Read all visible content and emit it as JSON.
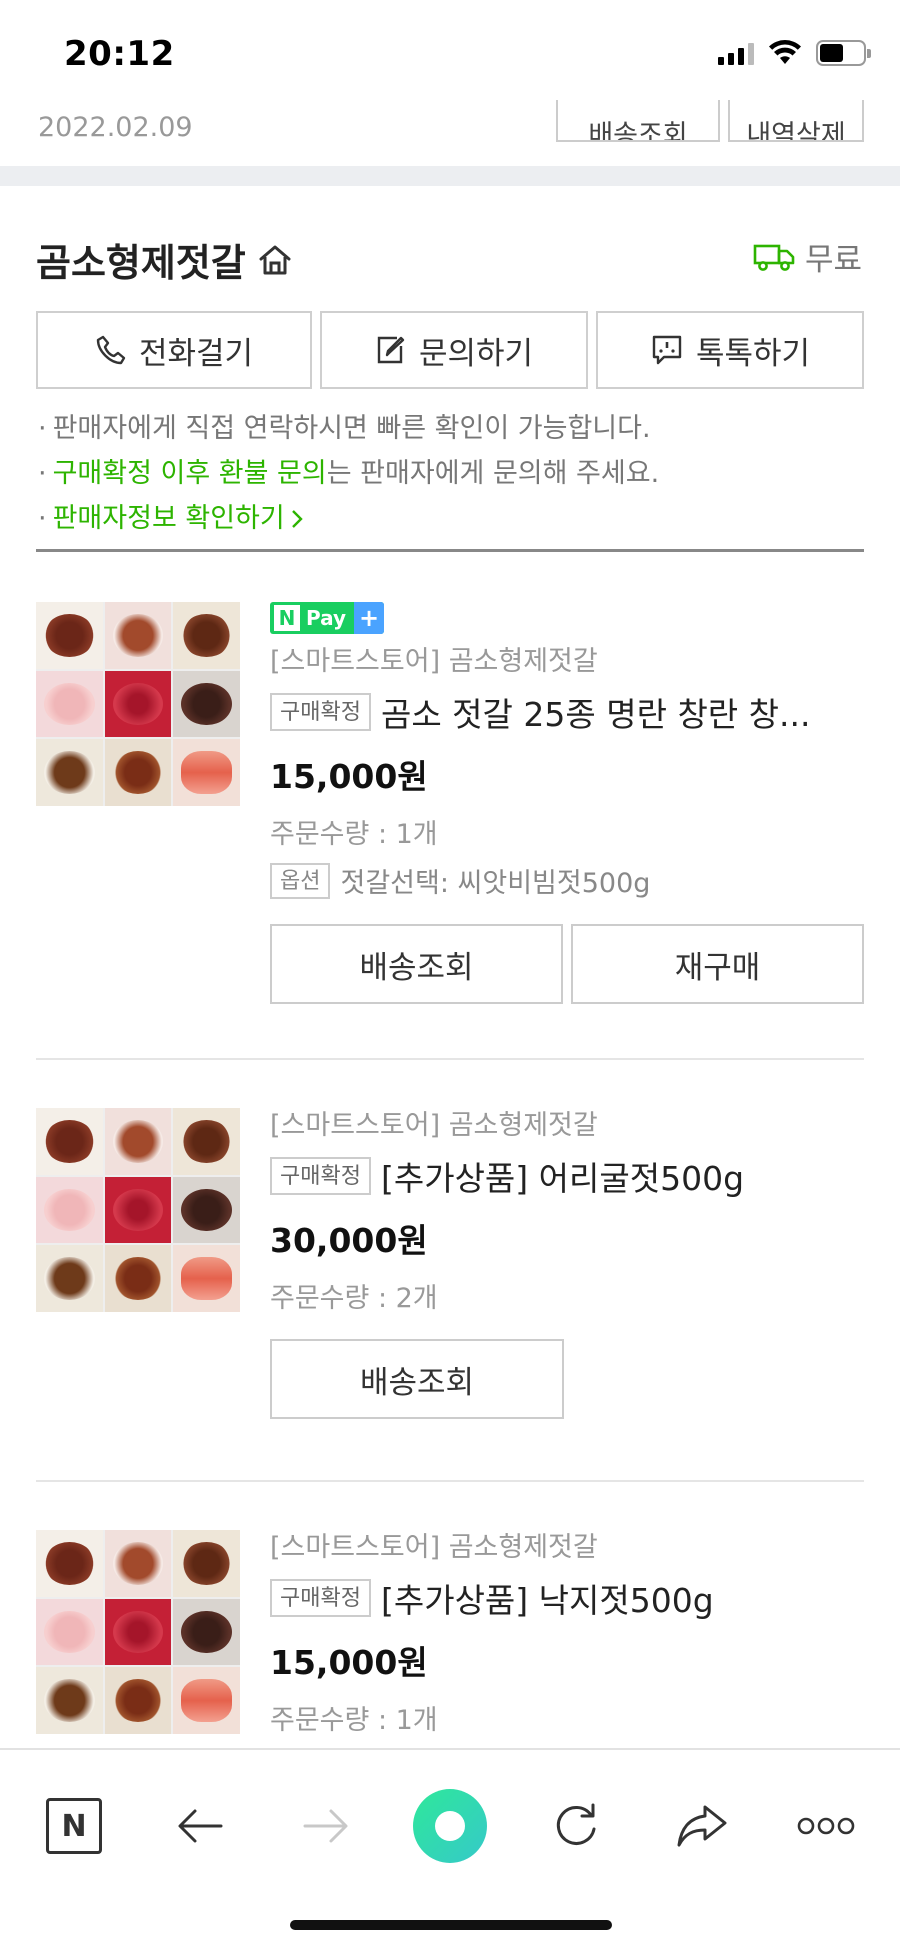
{
  "status_bar": {
    "time": "20:12"
  },
  "order_header": {
    "date": "2022.02.09",
    "btn1": "배송조회",
    "btn2": "내역삭제"
  },
  "seller": {
    "name": "곰소형제젓갈",
    "delivery": "무료",
    "actions": {
      "call": "전화걸기",
      "inquiry": "문의하기",
      "talk": "톡톡하기"
    },
    "notes": {
      "line1": "판매자에게 직접 연락하시면 빠른 확인이 가능합니다.",
      "line2_green": "구매확정 이후 환불 문의",
      "line2_rest": "는 판매자에게 문의해 주세요.",
      "line3": "판매자정보 확인하기"
    }
  },
  "products": [
    {
      "npay": "Pay",
      "store": "[스마트스토어] 곰소형제젓갈",
      "badge": "구매확정",
      "title": "곰소 젓갈 25종 명란 창란 창...",
      "price": "15,000원",
      "qty": "주문수량 : 1개",
      "option_badge": "옵션",
      "option_text": "젓갈선택: 씨앗비빔젓500g",
      "btn1": "배송조회",
      "btn2": "재구매"
    },
    {
      "store": "[스마트스토어] 곰소형제젓갈",
      "badge": "구매확정",
      "title": "[추가상품] 어리굴젓500g",
      "price": "30,000원",
      "qty": "주문수량 : 2개",
      "btn1": "배송조회"
    },
    {
      "store": "[스마트스토어] 곰소형제젓갈",
      "badge": "구매확정",
      "title": "[추가상품] 낙지젓500g",
      "price": "15,000원",
      "qty": "주문수량 : 1개"
    }
  ],
  "toolbar": {
    "icons": [
      "naver-n-icon",
      "back-arrow-icon",
      "forward-arrow-icon",
      "green-dot-icon",
      "refresh-icon",
      "share-icon",
      "more-dots-icon"
    ],
    "n_label": "N"
  },
  "colors": {
    "green": "#2db400",
    "npay_green": "#19ce60"
  }
}
